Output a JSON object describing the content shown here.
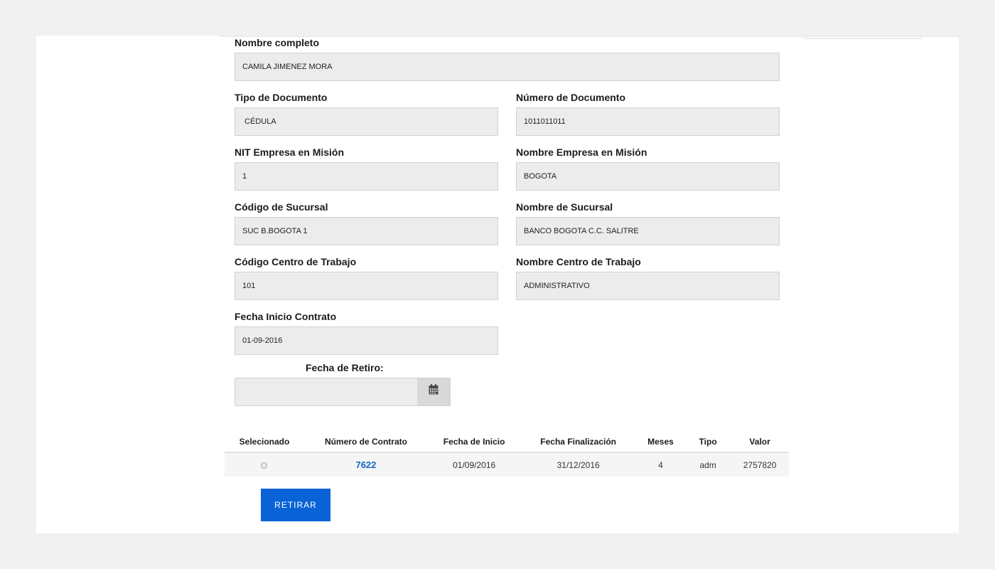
{
  "form": {
    "nombre_completo": {
      "label": "Nombre completo",
      "value": "CAMILA  JIMENEZ MORA"
    },
    "tipo_documento": {
      "label": "Tipo de Documento",
      "value": " CÉDULA"
    },
    "numero_documento": {
      "label": "Número de Documento",
      "value": "1011011011"
    },
    "nit_empresa": {
      "label": "NIT Empresa en Misión",
      "value": "1"
    },
    "nombre_empresa": {
      "label": "Nombre Empresa en Misión",
      "value": "BOGOTA"
    },
    "codigo_sucursal": {
      "label": "Código de Sucursal",
      "value": "SUC B.BOGOTA 1"
    },
    "nombre_sucursal": {
      "label": "Nombre de Sucursal",
      "value": "BANCO BOGOTA C.C. SALITRE"
    },
    "codigo_centro": {
      "label": "Código Centro de Trabajo",
      "value": "101"
    },
    "nombre_centro": {
      "label": "Nombre Centro de Trabajo",
      "value": "ADMINISTRATIVO"
    },
    "fecha_inicio": {
      "label": "Fecha Inicio Contrato",
      "value": "01-09-2016"
    },
    "fecha_retiro": {
      "label": "Fecha de Retiro:",
      "value": ""
    }
  },
  "contracts_table": {
    "headers": [
      "Selecionado",
      "Número de Contrato",
      "Fecha de Inicio",
      "Fecha Finalización",
      "Meses",
      "Tipo",
      "Valor"
    ],
    "rows": [
      {
        "numero": "7622",
        "inicio": "01/09/2016",
        "fin": "31/12/2016",
        "meses": "4",
        "tipo": "adm",
        "valor": "2757820"
      }
    ]
  },
  "actions": {
    "retirar_label": "RETIRAR"
  },
  "colors": {
    "button": "#0a63d6",
    "link": "#1565c0",
    "field_bg": "#ececec"
  },
  "icons": {
    "date_picker": "calendar-icon"
  }
}
